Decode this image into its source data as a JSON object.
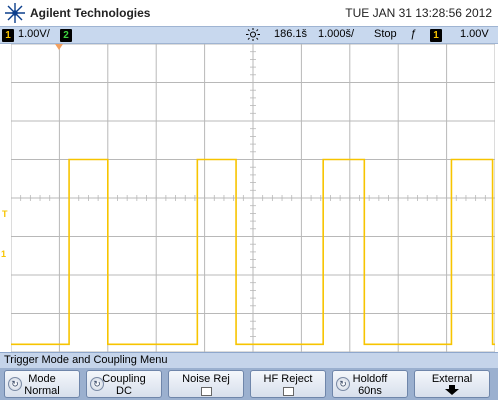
{
  "header": {
    "brand": "Agilent Technologies",
    "datetime": "TUE JAN 31 13:28:56 2012"
  },
  "status_bar": {
    "ch1_number": "1",
    "ch1_scale": "1.00V/",
    "ch2_number": "2",
    "time_delay": "186.1š",
    "time_scale": "1.000š/",
    "run_state": "Stop",
    "trigger_slope_symbol": "ƒ",
    "trigger_channel": "1",
    "trigger_level": "1.00V"
  },
  "colors": {
    "ch1_trace": "#f7c400",
    "grid": "#b8b8b8",
    "background": "#ffffff",
    "status_bg": "#c8d8ee",
    "softkey_bg": "#9bb0cf"
  },
  "markers": {
    "trigger_marker": "T",
    "ground_marker": "1"
  },
  "menu": {
    "title": "Trigger Mode and Coupling Menu",
    "softkeys": [
      {
        "line1": "Mode",
        "line2": "Normal",
        "icon": "knob-icon"
      },
      {
        "line1": "Coupling",
        "line2": "DC",
        "icon": "knob-icon"
      },
      {
        "line1": "Noise Rej",
        "line2": "",
        "icon": "checkbox-icon"
      },
      {
        "line1": "HF Reject",
        "line2": "",
        "icon": "checkbox-icon"
      },
      {
        "line1": "Holdoff",
        "line2": "60ns",
        "icon": "knob-icon"
      },
      {
        "line1": "External",
        "line2": "",
        "icon": "down-arrow-icon"
      }
    ]
  },
  "waveform": {
    "type": "square",
    "channel": "1",
    "rise_edges_divisions": [
      1.2,
      3.85,
      6.45,
      9.1
    ],
    "fall_edges_divisions": [
      2.0,
      4.65,
      7.3,
      9.95
    ],
    "high_level_divisions": 5.0,
    "low_level_divisions": 0.2
  }
}
